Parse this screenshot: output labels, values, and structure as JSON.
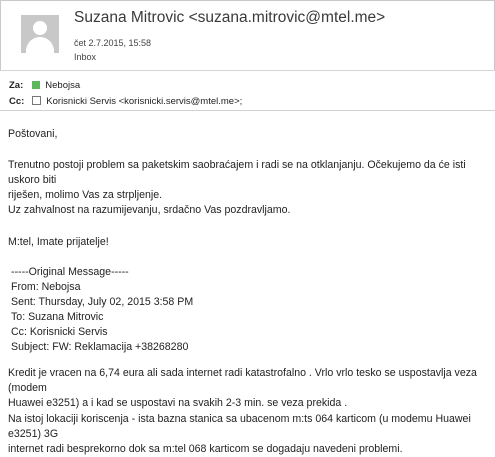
{
  "header": {
    "sender": "Suzana Mitrovic <suzana.mitrovic@mtel.me>",
    "date": "čet 2.7.2015, 15:58",
    "folder": "Inbox"
  },
  "recipients": {
    "to_label": "Za:",
    "to_name": "Nebojsa",
    "cc_label": "Cc:",
    "cc_value": "Korisnicki Servis <korisnicki.servis@mtel.me>;"
  },
  "message": {
    "greeting": "Poštovani,",
    "para1_line1": "Trenutno postoji problem sa paketskim saobraćajem i radi se na otklanjanju. Očekujemo da će isti uskoro biti",
    "para1_line2": "riješen, molimo Vas za strpljenje.",
    "para2": "Uz zahvalnost na razumijevanju, srdačno Vas pozdravljamo.",
    "para3": "M:tel, Imate prijatelje!"
  },
  "original": {
    "separator": "-----Original Message-----",
    "from": "From: Nebojsa",
    "sent": "Sent: Thursday, July 02, 2015 3:58 PM",
    "to": "To: Suzana Mitrovic",
    "cc": "Cc: Korisnicki Servis",
    "subject": "Subject: FW: Reklamacija +38268280",
    "body1_line1": "Kredit je vracen na 6,74 eura ali sada internet radi katastrofalno . Vrlo vrlo tesko se uspostavlja veza (modem",
    "body1_line2": "Huawei e3251) a i kad se uspostavi na svakih 2-3 min. se veza prekida  .",
    "body2_line1": "Na istoj lokaciji koriscenja - ista bazna stanica sa ubacenom m:ts 064 karticom (u modemu Huawei e3251) 3G",
    "body2_line2": "internet radi besprekorno dok sa m:tel 068 karticom se dogadaju navedeni problemi."
  },
  "colors": {
    "presence_available": "#5cb85c"
  }
}
